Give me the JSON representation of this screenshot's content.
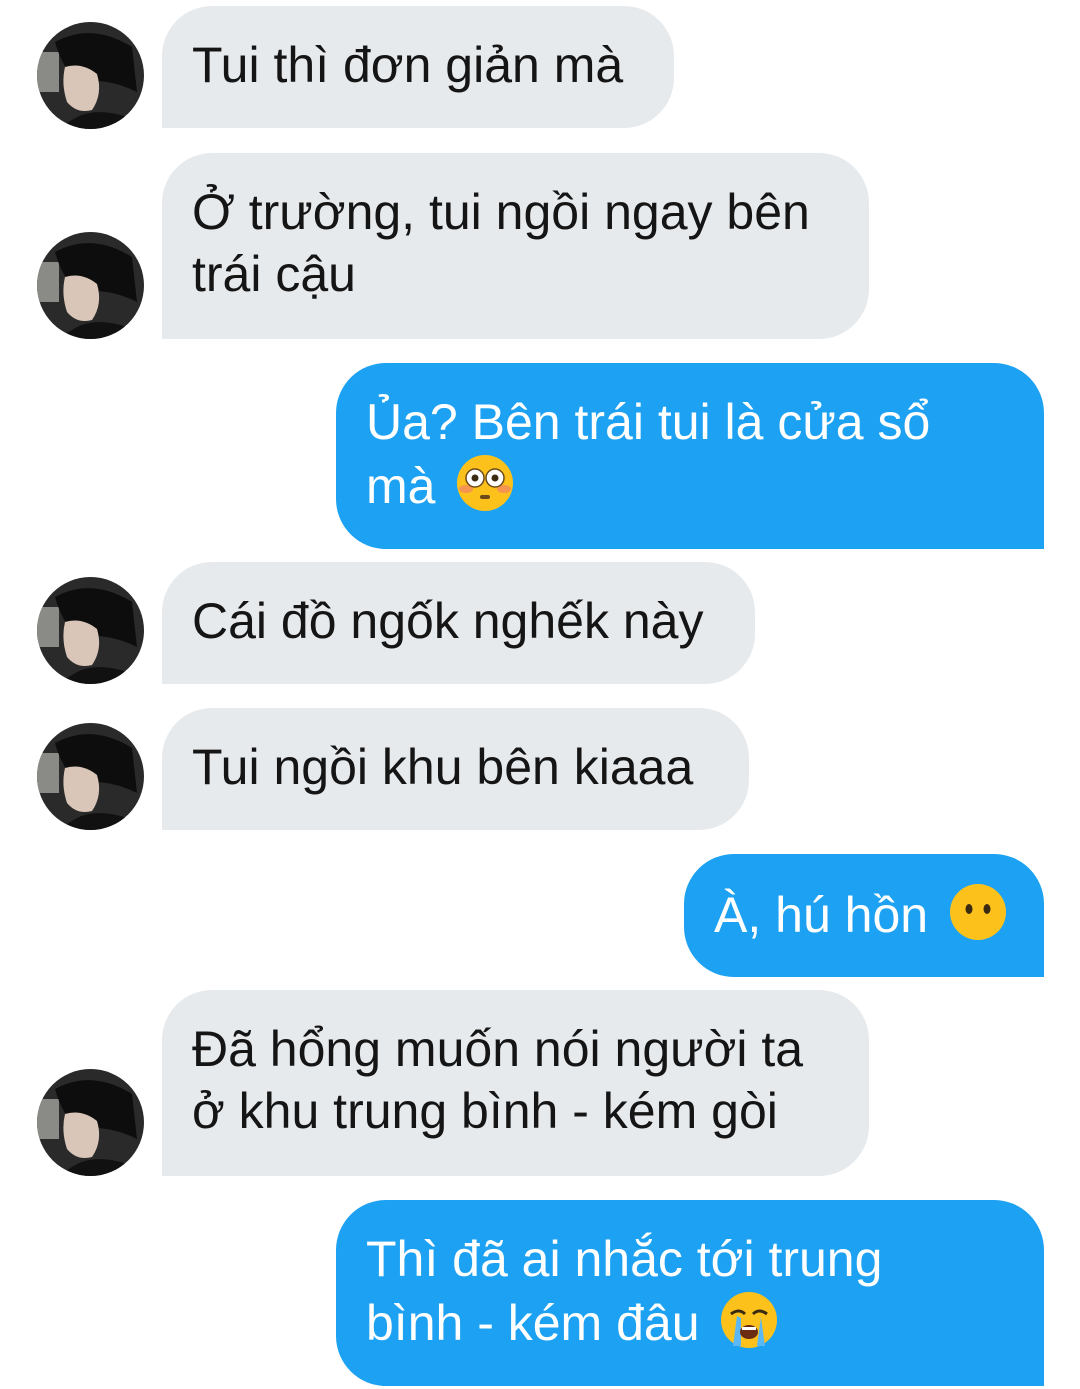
{
  "messages": [
    {
      "sender": "them",
      "lines": [
        "Tui thì đơn giản mà"
      ]
    },
    {
      "sender": "them",
      "lines": [
        "Ở trường, tui ngồi ngay bên",
        "trái cậu"
      ]
    },
    {
      "sender": "me",
      "lines": [
        "Ủa? Bên trái tui là cửa sổ",
        "mà"
      ],
      "emoji": "flushed-face-icon"
    },
    {
      "sender": "them",
      "lines": [
        "Cái đồ ngốk nghếk này"
      ]
    },
    {
      "sender": "them",
      "lines": [
        "Tui ngồi khu bên kiaaa"
      ]
    },
    {
      "sender": "me",
      "lines": [
        "À, hú hồn"
      ],
      "emoji": "face-without-mouth-icon"
    },
    {
      "sender": "them",
      "lines": [
        "Đã hổng muốn nói người ta",
        "ở khu trung bình - kém gòi"
      ]
    },
    {
      "sender": "me",
      "lines": [
        "Thì đã ai nhắc tới trung",
        "bình - kém đâu"
      ],
      "emoji": "loudly-crying-face-icon"
    }
  ],
  "colors": {
    "incoming_bubble": "#e7eaed",
    "outgoing_bubble": "#1da1f2",
    "incoming_text": "#151515",
    "outgoing_text": "#ffffff"
  }
}
